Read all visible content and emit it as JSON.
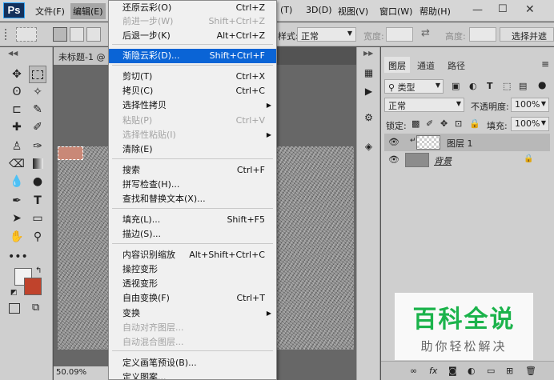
{
  "app": {
    "logo": "Ps"
  },
  "menubar": {
    "items": [
      "文件(F)",
      "编辑(E)",
      "(T)",
      "3D(D)",
      "视图(V)",
      "窗口(W)",
      "帮助(H)"
    ]
  },
  "options": {
    "style_label": "样式:",
    "style_value": "正常",
    "width_label": "宽度:",
    "height_label": "高度:",
    "select_button": "选择并遮"
  },
  "document": {
    "tab_title": "未标题-1 @",
    "zoom": "50.09%"
  },
  "edit_menu": [
    {
      "label": "还原云彩(O)",
      "shortcut": "Ctrl+Z",
      "state": "normal"
    },
    {
      "label": "前进一步(W)",
      "shortcut": "Shift+Ctrl+Z",
      "state": "disabled"
    },
    {
      "label": "后退一步(K)",
      "shortcut": "Alt+Ctrl+Z",
      "state": "normal"
    },
    {
      "label": "渐隐云彩(D)...",
      "shortcut": "Shift+Ctrl+F",
      "state": "highlighted"
    },
    {
      "label": "剪切(T)",
      "shortcut": "Ctrl+X",
      "state": "normal"
    },
    {
      "label": "拷贝(C)",
      "shortcut": "Ctrl+C",
      "state": "normal"
    },
    {
      "label": "选择性拷贝",
      "shortcut": "",
      "state": "normal",
      "submenu": true
    },
    {
      "label": "粘贴(P)",
      "shortcut": "Ctrl+V",
      "state": "disabled"
    },
    {
      "label": "选择性粘贴(I)",
      "shortcut": "",
      "state": "disabled",
      "submenu": true
    },
    {
      "label": "清除(E)",
      "shortcut": "",
      "state": "normal"
    },
    {
      "label": "搜索",
      "shortcut": "Ctrl+F",
      "state": "normal"
    },
    {
      "label": "拼写检查(H)...",
      "shortcut": "",
      "state": "normal"
    },
    {
      "label": "查找和替换文本(X)...",
      "shortcut": "",
      "state": "normal"
    },
    {
      "label": "填充(L)...",
      "shortcut": "Shift+F5",
      "state": "normal"
    },
    {
      "label": "描边(S)...",
      "shortcut": "",
      "state": "normal"
    },
    {
      "label": "内容识别缩放",
      "shortcut": "Alt+Shift+Ctrl+C",
      "state": "normal"
    },
    {
      "label": "操控变形",
      "shortcut": "",
      "state": "normal"
    },
    {
      "label": "透视变形",
      "shortcut": "",
      "state": "normal"
    },
    {
      "label": "自由变换(F)",
      "shortcut": "Ctrl+T",
      "state": "normal"
    },
    {
      "label": "变换",
      "shortcut": "",
      "state": "normal",
      "submenu": true
    },
    {
      "label": "自动对齐图层...",
      "shortcut": "",
      "state": "disabled"
    },
    {
      "label": "自动混合图层...",
      "shortcut": "",
      "state": "disabled"
    },
    {
      "label": "定义画笔预设(B)...",
      "shortcut": "",
      "state": "normal"
    },
    {
      "label": "定义图案...",
      "shortcut": "",
      "state": "normal"
    }
  ],
  "layers_panel": {
    "tabs": [
      "图层",
      "通道",
      "路径"
    ],
    "filter_kind": "类型",
    "blend_mode": "正常",
    "opacity_label": "不透明度:",
    "opacity_value": "100%",
    "lock_label": "锁定:",
    "fill_label": "填充:",
    "fill_value": "100%",
    "layers": [
      {
        "name": "图层 1",
        "selected": true
      },
      {
        "name": "背景",
        "selected": false,
        "locked": true
      }
    ]
  },
  "watermark": {
    "title": "百科全说",
    "subtitle": "助你轻松解决"
  },
  "colors": {
    "highlight": "#0a64d6",
    "foreground_swatch": "#f2f2f2",
    "background_swatch": "#c0432c",
    "selection_fill": "#c98877",
    "watermark_green": "#1bb34b"
  }
}
